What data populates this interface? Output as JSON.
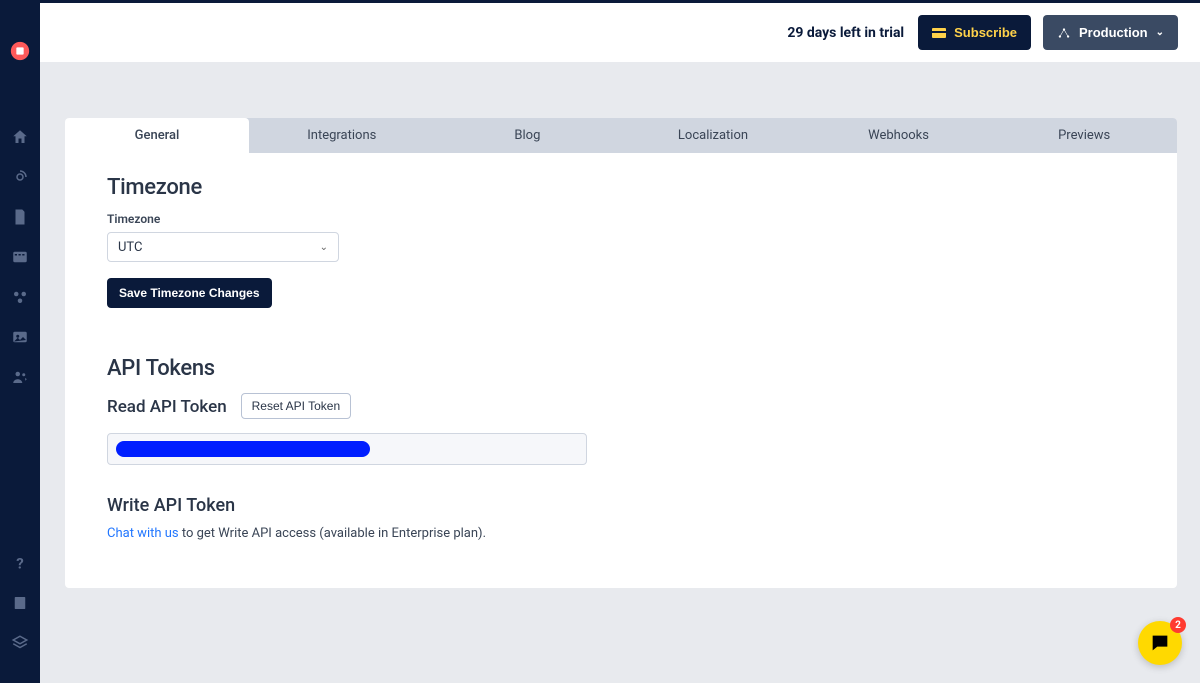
{
  "header": {
    "trial_text": "29 days left in trial",
    "subscribe_label": "Subscribe",
    "environment_label": "Production"
  },
  "sidebar": {
    "items": [
      {
        "name": "home"
      },
      {
        "name": "blog"
      },
      {
        "name": "document"
      },
      {
        "name": "calendar"
      },
      {
        "name": "integrations"
      },
      {
        "name": "media"
      },
      {
        "name": "team"
      }
    ],
    "bottom_items": [
      {
        "name": "help"
      },
      {
        "name": "docs"
      },
      {
        "name": "layers"
      }
    ]
  },
  "tabs": [
    {
      "label": "General",
      "active": true
    },
    {
      "label": "Integrations",
      "active": false
    },
    {
      "label": "Blog",
      "active": false
    },
    {
      "label": "Localization",
      "active": false
    },
    {
      "label": "Webhooks",
      "active": false
    },
    {
      "label": "Previews",
      "active": false
    }
  ],
  "timezone": {
    "heading": "Timezone",
    "field_label": "Timezone",
    "selected": "UTC",
    "save_label": "Save Timezone Changes"
  },
  "api": {
    "heading": "API Tokens",
    "read_label": "Read API Token",
    "reset_label": "Reset API Token",
    "write_label": "Write API Token",
    "write_help_link": "Chat with us",
    "write_help_rest": " to get Write API access (available in Enterprise plan)."
  },
  "chat": {
    "badge_count": "2"
  }
}
